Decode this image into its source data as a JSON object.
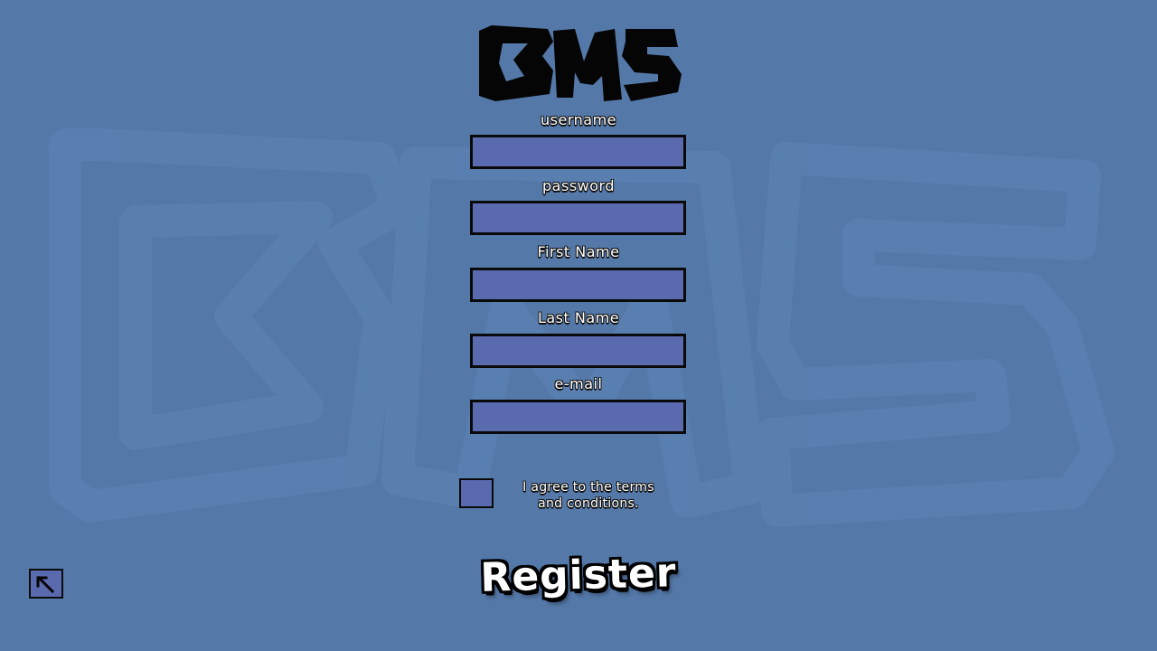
{
  "app": {
    "logo_text": "BMS"
  },
  "form": {
    "fields": [
      {
        "label": "username",
        "value": "",
        "placeholder": ""
      },
      {
        "label": "password",
        "value": "",
        "placeholder": ""
      },
      {
        "label": "First Name",
        "value": "",
        "placeholder": ""
      },
      {
        "label": "Last Name",
        "value": "",
        "placeholder": ""
      },
      {
        "label": "e-mail",
        "value": "",
        "placeholder": ""
      }
    ],
    "terms_line1": "I agree to the terms",
    "terms_line2": "and conditions.",
    "terms_checked": false,
    "register_label": "Register"
  },
  "nav": {
    "back_icon": "arrow-up-left-icon"
  },
  "colors": {
    "background": "#5478a8",
    "input_fill": "#5a6aaf",
    "border": "#0a0a0a",
    "text": "#ffffff"
  }
}
